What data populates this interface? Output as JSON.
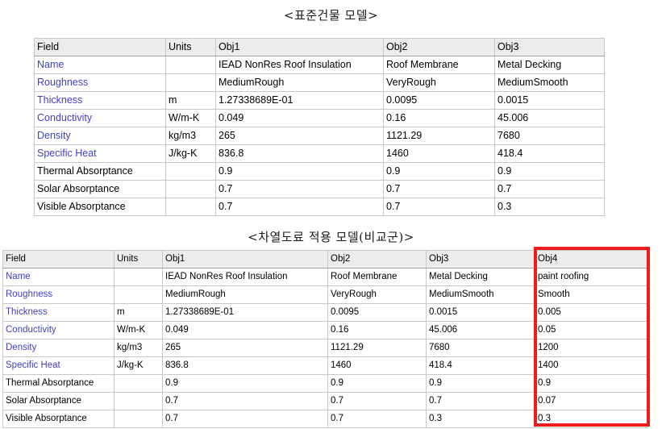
{
  "captions": {
    "standard_model": "<표준건물 모델>",
    "coated_model": "<차열도료 적용 모델(비교군)>"
  },
  "colors": {
    "field_label": "#4141c5",
    "highlight_box": "#ee1c1c",
    "header_background": "#ececeb",
    "grid_line": "#c8c8c8"
  },
  "table_standard_model": {
    "headers": [
      "Field",
      "Units",
      "Obj1",
      "Obj2",
      "Obj3"
    ],
    "rows": [
      {
        "field": "Name",
        "field_blue": true,
        "units": "",
        "obj1": "IEAD NonRes Roof Insulation",
        "obj2": "Roof Membrane",
        "obj3": "Metal Decking"
      },
      {
        "field": "Roughness",
        "field_blue": true,
        "units": "",
        "obj1": "MediumRough",
        "obj2": "VeryRough",
        "obj3": "MediumSmooth"
      },
      {
        "field": "Thickness",
        "field_blue": true,
        "units": "m",
        "obj1": "1.27338689E-01",
        "obj2": "0.0095",
        "obj3": "0.0015"
      },
      {
        "field": "Conductivity",
        "field_blue": true,
        "units": "W/m-K",
        "obj1": "0.049",
        "obj2": "0.16",
        "obj3": "45.006"
      },
      {
        "field": "Density",
        "field_blue": true,
        "units": "kg/m3",
        "obj1": "265",
        "obj2": "1121.29",
        "obj3": "7680"
      },
      {
        "field": "Specific Heat",
        "field_blue": true,
        "units": "J/kg-K",
        "obj1": "836.8",
        "obj2": "1460",
        "obj3": "418.4"
      },
      {
        "field": "Thermal Absorptance",
        "field_blue": false,
        "units": "",
        "obj1": "0.9",
        "obj2": "0.9",
        "obj3": "0.9"
      },
      {
        "field": "Solar Absorptance",
        "field_blue": false,
        "units": "",
        "obj1": "0.7",
        "obj2": "0.7",
        "obj3": "0.7"
      },
      {
        "field": "Visible Absorptance",
        "field_blue": false,
        "units": "",
        "obj1": "0.7",
        "obj2": "0.7",
        "obj3": "0.3"
      }
    ]
  },
  "table_coated_model": {
    "headers": [
      "Field",
      "Units",
      "Obj1",
      "Obj2",
      "Obj3",
      "Obj4"
    ],
    "highlighted_column": "Obj4",
    "rows": [
      {
        "field": "Name",
        "field_blue": true,
        "units": "",
        "obj1": "IEAD NonRes Roof Insulation",
        "obj2": "Roof Membrane",
        "obj3": "Metal Decking",
        "obj4": "paint roofing"
      },
      {
        "field": "Roughness",
        "field_blue": true,
        "units": "",
        "obj1": "MediumRough",
        "obj2": "VeryRough",
        "obj3": "MediumSmooth",
        "obj4": "Smooth"
      },
      {
        "field": "Thickness",
        "field_blue": true,
        "units": "m",
        "obj1": "1.27338689E-01",
        "obj2": "0.0095",
        "obj3": "0.0015",
        "obj4": "0.005"
      },
      {
        "field": "Conductivity",
        "field_blue": true,
        "units": "W/m-K",
        "obj1": "0.049",
        "obj2": "0.16",
        "obj3": "45.006",
        "obj4": "0.05"
      },
      {
        "field": "Density",
        "field_blue": true,
        "units": "kg/m3",
        "obj1": "265",
        "obj2": "1121.29",
        "obj3": "7680",
        "obj4": "1200"
      },
      {
        "field": "Specific Heat",
        "field_blue": true,
        "units": "J/kg-K",
        "obj1": "836.8",
        "obj2": "1460",
        "obj3": "418.4",
        "obj4": "1400"
      },
      {
        "field": "Thermal Absorptance",
        "field_blue": false,
        "units": "",
        "obj1": "0.9",
        "obj2": "0.9",
        "obj3": "0.9",
        "obj4": "0.9"
      },
      {
        "field": "Solar Absorptance",
        "field_blue": false,
        "units": "",
        "obj1": "0.7",
        "obj2": "0.7",
        "obj3": "0.7",
        "obj4": "0.07"
      },
      {
        "field": "Visible Absorptance",
        "field_blue": false,
        "units": "",
        "obj1": "0.7",
        "obj2": "0.7",
        "obj3": "0.3",
        "obj4": "0.3"
      }
    ]
  }
}
